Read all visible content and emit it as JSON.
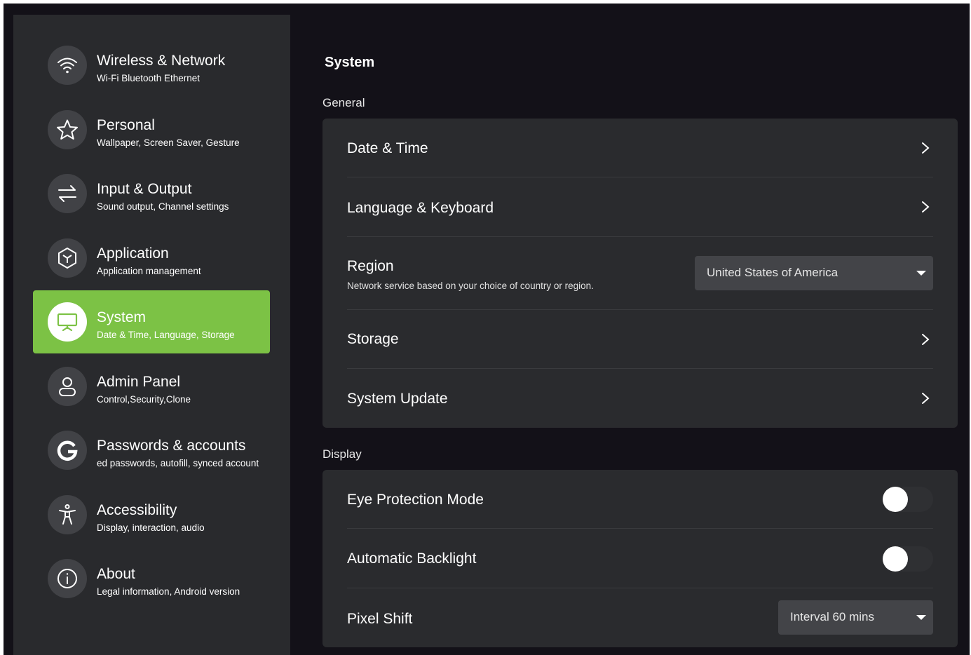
{
  "sidebar": {
    "items": [
      {
        "title": "Wireless & Network",
        "subtitle": "Wi-Fi Bluetooth Ethernet",
        "icon": "wifi-icon"
      },
      {
        "title": "Personal",
        "subtitle": "Wallpaper, Screen Saver, Gesture",
        "icon": "star-icon"
      },
      {
        "title": "Input & Output",
        "subtitle": "Sound output, Channel settings",
        "icon": "swap-icon"
      },
      {
        "title": "Application",
        "subtitle": "Application management",
        "icon": "cube-icon"
      },
      {
        "title": "System",
        "subtitle": "Date & Time, Language, Storage",
        "icon": "presentation-icon",
        "active": true
      },
      {
        "title": "Admin Panel",
        "subtitle": "Control,Security,Clone",
        "icon": "user-icon"
      },
      {
        "title": "Passwords & accounts",
        "subtitle": "ed passwords, autofill, synced account",
        "icon": "google-icon"
      },
      {
        "title": "Accessibility",
        "subtitle": "Display, interaction, audio",
        "icon": "accessibility-icon"
      },
      {
        "title": "About",
        "subtitle": "Legal information, Android version",
        "icon": "info-icon"
      }
    ]
  },
  "main": {
    "title": "System",
    "general": {
      "label": "General",
      "date_time": "Date & Time",
      "language_keyboard": "Language & Keyboard",
      "region": {
        "title": "Region",
        "subtitle": "Network service based on your choice of country or region.",
        "value": "United States of America"
      },
      "storage": "Storage",
      "system_update": "System Update"
    },
    "display": {
      "label": "Display",
      "eye_protection": {
        "title": "Eye Protection Mode",
        "enabled": false
      },
      "auto_backlight": {
        "title": "Automatic Backlight",
        "enabled": false
      },
      "pixel_shift": {
        "title": "Pixel Shift",
        "value": "Interval 60 mins"
      }
    }
  },
  "colors": {
    "background": "#131118",
    "sidebar": "#292a2d",
    "card": "#2a2b2e",
    "accent": "#7cc245"
  }
}
